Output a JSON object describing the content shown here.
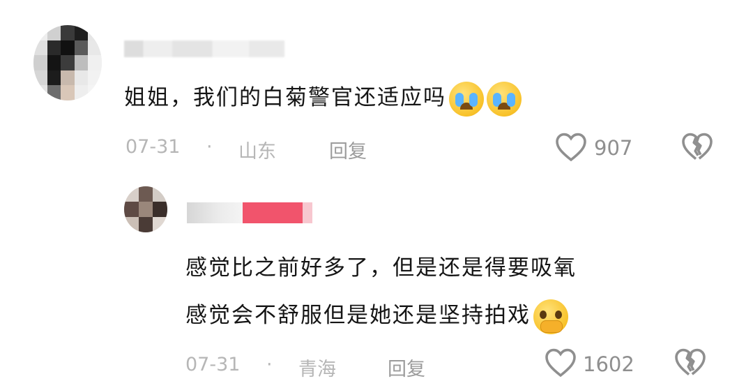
{
  "comment1": {
    "text": "姐姐，我们的白菊警官还适应吗",
    "emoji": "loudly-crying-face",
    "date": "07-31",
    "dot": "·",
    "location": "山东",
    "reply_label": "回复",
    "likes": "907"
  },
  "comment2": {
    "line1": "感觉比之前好多了，但是还是得要吸氧",
    "line2": "感觉会不舒服但是她还是坚持拍戏",
    "emoji": "pleading-face-with-hands",
    "date": "07-31",
    "dot": "·",
    "location": "青海",
    "reply_label": "回复",
    "likes": "1602"
  },
  "colors": {
    "text": "#151515",
    "meta": "#b6b6b6",
    "icon": "#8f8f8f",
    "emoji": "#f8c22a"
  }
}
